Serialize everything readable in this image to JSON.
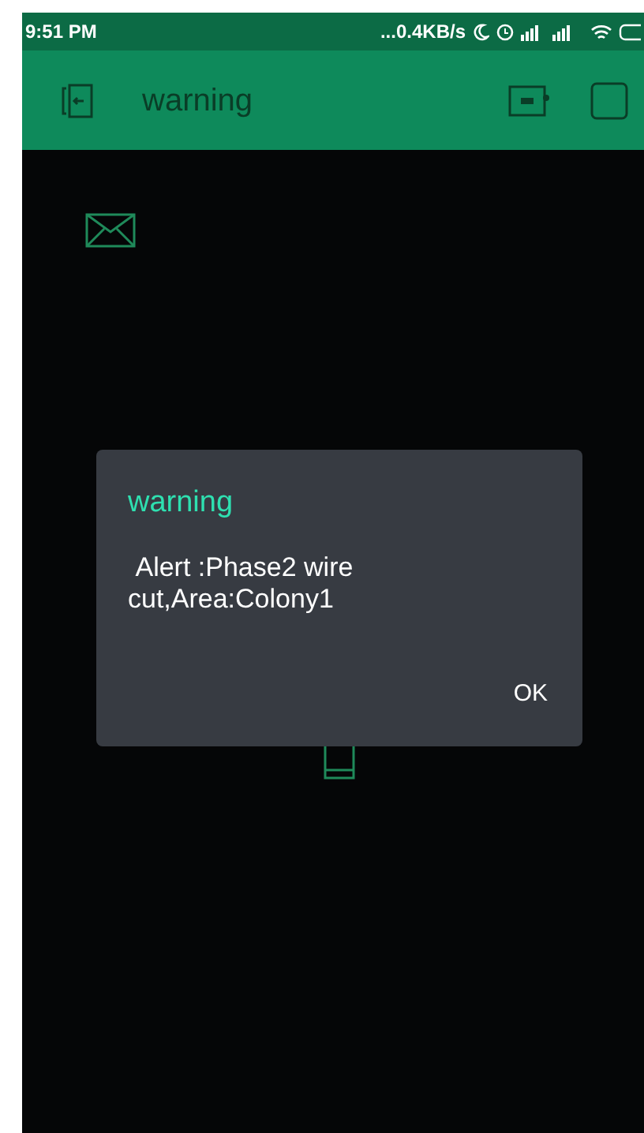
{
  "status_bar": {
    "time": "9:51 PM",
    "network_speed": "...0.4KB/s"
  },
  "app_bar": {
    "title": "warning"
  },
  "dialog": {
    "title": "warning",
    "message": " Alert :Phase2 wire cut,Area:Colony1",
    "buttons": [
      "OK"
    ]
  }
}
